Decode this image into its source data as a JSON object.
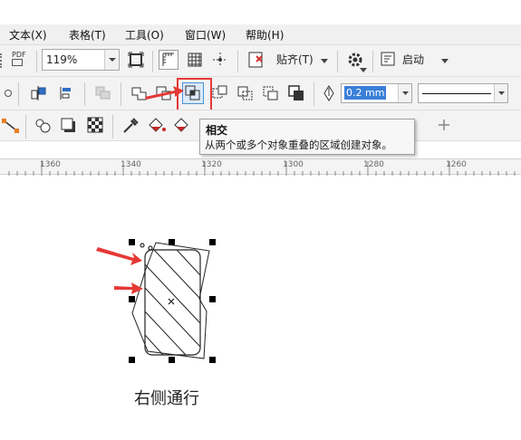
{
  "menu": {
    "items": [
      {
        "id": "text",
        "label": "文本(X)"
      },
      {
        "id": "table",
        "label": "表格(T)"
      },
      {
        "id": "tools",
        "label": "工具(O)"
      },
      {
        "id": "window",
        "label": "窗口(W)"
      },
      {
        "id": "help",
        "label": "帮助(H)"
      }
    ]
  },
  "toolbar": {
    "zoom_value": "119%",
    "pdf_label": "PDF",
    "snap_label": "贴齐(T)",
    "launch_label": "启动"
  },
  "property_bar": {
    "outline_width": "0.2 mm"
  },
  "tooltip": {
    "title": "相交",
    "description": "从两个或多个对象重叠的区域创建对象。"
  },
  "ruler": {
    "labels": [
      "1360",
      "1340",
      "1320",
      "1300",
      "1280",
      "1260"
    ]
  },
  "canvas": {
    "caption": "右侧通行"
  },
  "colors": {
    "highlight_box": "#e53935",
    "arrow": "#e53935",
    "selected_field": "#3b7fd9"
  }
}
